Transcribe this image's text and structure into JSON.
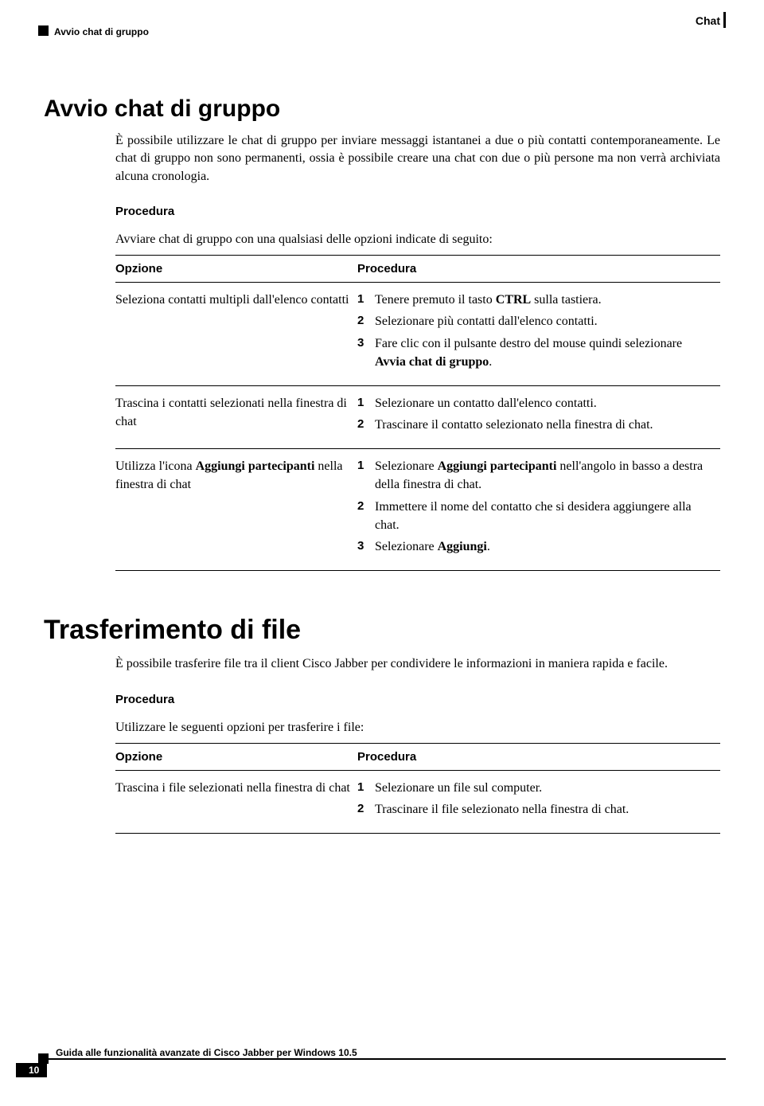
{
  "header": {
    "chapter": "Chat",
    "section": "Avvio chat di gruppo"
  },
  "section1": {
    "title": "Avvio chat di gruppo",
    "intro": "È possibile utilizzare le chat di gruppo per inviare messaggi istantanei a due o più contatti contemporaneamente. Le chat di gruppo non sono permanenti, ossia è possibile creare una chat con due o più persone ma non verrà archiviata alcuna cronologia.",
    "proc_label": "Procedura",
    "lead": "Avviare chat di gruppo con una qualsiasi delle opzioni indicate di seguito:",
    "table": {
      "col1": "Opzione",
      "col2": "Procedura",
      "rows": [
        {
          "opt": "Seleziona contatti multipli dall'elenco contatti",
          "steps": [
            {
              "n": "1",
              "pre": "Tenere premuto il tasto ",
              "bold": "CTRL",
              "post": " sulla tastiera."
            },
            {
              "n": "2",
              "pre": "Selezionare più contatti dall'elenco contatti.",
              "bold": "",
              "post": ""
            },
            {
              "n": "3",
              "pre": "Fare clic con il pulsante destro del mouse quindi selezionare ",
              "bold": "Avvia chat di gruppo",
              "post": "."
            }
          ]
        },
        {
          "opt": "Trascina i contatti selezionati nella finestra di chat",
          "steps": [
            {
              "n": "1",
              "pre": "Selezionare un contatto dall'elenco contatti.",
              "bold": "",
              "post": ""
            },
            {
              "n": "2",
              "pre": "Trascinare il contatto selezionato nella finestra di chat.",
              "bold": "",
              "post": ""
            }
          ]
        },
        {
          "opt_pre": "Utilizza l'icona ",
          "opt_bold": "Aggiungi partecipanti",
          "opt_post": " nella finestra di chat",
          "steps": [
            {
              "n": "1",
              "pre": "Selezionare ",
              "bold": "Aggiungi partecipanti",
              "post": " nell'angolo in basso a destra della finestra di chat."
            },
            {
              "n": "2",
              "pre": "Immettere il nome del contatto che si desidera aggiungere alla chat.",
              "bold": "",
              "post": ""
            },
            {
              "n": "3",
              "pre": "Selezionare ",
              "bold": "Aggiungi",
              "post": "."
            }
          ]
        }
      ]
    }
  },
  "section2": {
    "title": "Trasferimento di file",
    "intro": "È possibile trasferire file tra il client Cisco Jabber per condividere le informazioni in maniera rapida e facile.",
    "proc_label": "Procedura",
    "lead": "Utilizzare le seguenti opzioni per trasferire i file:",
    "table": {
      "col1": "Opzione",
      "col2": "Procedura",
      "rows": [
        {
          "opt": "Trascina i file selezionati nella finestra di chat",
          "steps": [
            {
              "n": "1",
              "pre": "Selezionare un file sul computer.",
              "bold": "",
              "post": ""
            },
            {
              "n": "2",
              "pre": "Trascinare il file selezionato nella finestra di chat.",
              "bold": "",
              "post": ""
            }
          ]
        }
      ]
    }
  },
  "footer": {
    "title": "Guida alle funzionalità avanzate di Cisco Jabber per Windows 10.5",
    "page": "10"
  }
}
